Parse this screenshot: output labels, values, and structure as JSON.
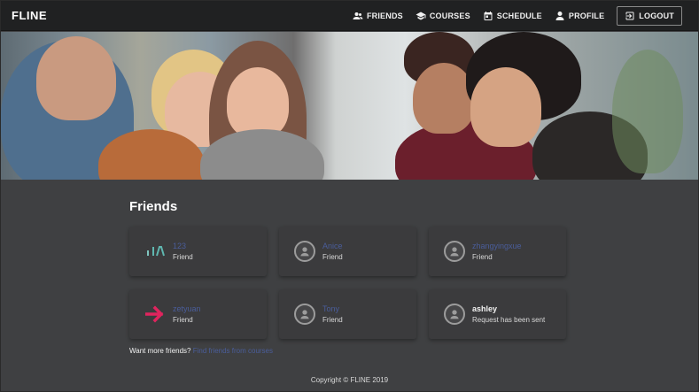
{
  "brand": "FLINE",
  "nav": {
    "friends": "FRIENDS",
    "courses": "COURSES",
    "schedule": "SCHEDULE",
    "profile": "PROFILE",
    "logout": "LOGOUT"
  },
  "page_title": "Friends",
  "friends": [
    {
      "name": "123",
      "status": "Friend",
      "avatar": "logo-icon"
    },
    {
      "name": "Anice",
      "status": "Friend",
      "avatar": "user-icon"
    },
    {
      "name": "zhangyingxue",
      "status": "Friend",
      "avatar": "user-icon"
    },
    {
      "name": "zetyuan",
      "status": "Friend",
      "avatar": "arrow-right-icon"
    },
    {
      "name": "Tony",
      "status": "Friend",
      "avatar": "user-icon"
    },
    {
      "name": "ashley",
      "status": "Request has been sent",
      "avatar": "user-icon"
    }
  ],
  "more": {
    "prompt": "Want more friends?",
    "link": "Find friends from courses"
  },
  "footer": "Copyright © FLINE 2019",
  "colors": {
    "topbar": "#202122",
    "background": "#3f4042",
    "card": "#3b3b3d",
    "link": "#4a5d9a",
    "arrow": "#e0245e"
  }
}
